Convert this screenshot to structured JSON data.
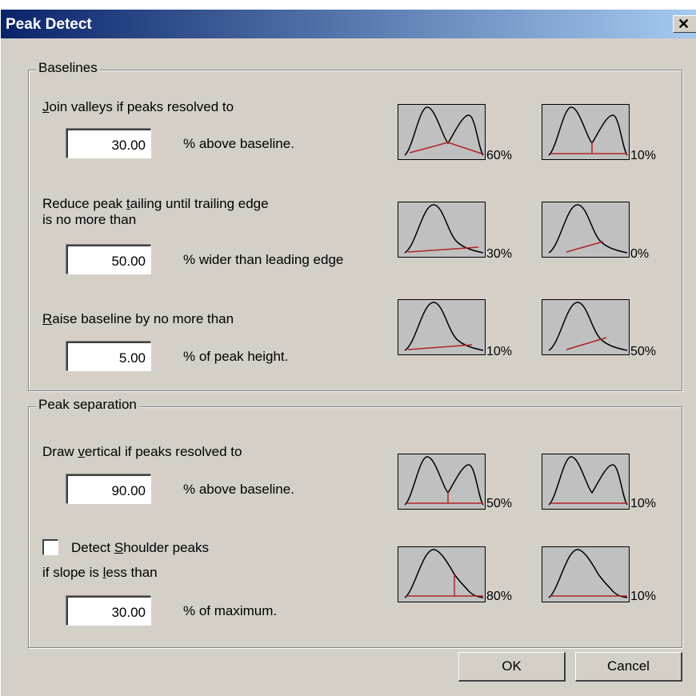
{
  "window": {
    "title": "Peak Detect",
    "close_glyph": "✕"
  },
  "baselines": {
    "legend": "Baselines",
    "join": {
      "label_pre": "",
      "label_key": "J",
      "label_post": "oin valleys if peaks resolved to",
      "value": "30.00",
      "unit": "% above baseline.",
      "thumb1_pct": "60%",
      "thumb2_pct": "10%"
    },
    "tailing": {
      "line1_pre": "Reduce peak ",
      "line1_key": "t",
      "line1_post": "ailing until trailing edge",
      "line2": "is no more than",
      "value": "50.00",
      "unit": "% wider than leading edge",
      "thumb1_pct": "30%",
      "thumb2_pct": "0%"
    },
    "raise": {
      "label_pre": "",
      "label_key": "R",
      "label_post": "aise baseline by no more than",
      "value": "5.00",
      "unit": "% of peak height.",
      "thumb1_pct": "10%",
      "thumb2_pct": "50%"
    }
  },
  "separation": {
    "legend": "Peak separation",
    "vertical": {
      "label_pre": "Draw ",
      "label_key": "v",
      "label_post": "ertical if peaks resolved to",
      "value": "90.00",
      "unit": "% above baseline.",
      "thumb1_pct": "50%",
      "thumb2_pct": "10%"
    },
    "shoulder": {
      "check_pre": "Detect ",
      "check_key": "S",
      "check_post": "houlder peaks",
      "checked": false,
      "line2_pre": "if slope is ",
      "line2_key": "l",
      "line2_post": "ess than",
      "value": "30.00",
      "unit": "% of maximum.",
      "thumb1_pct": "80%",
      "thumb2_pct": "10%"
    }
  },
  "buttons": {
    "ok": "OK",
    "cancel": "Cancel"
  },
  "colors": {
    "titlebar_start": "#0a246a",
    "titlebar_end": "#a6caf0",
    "baseline_line": "#b22222",
    "face": "#d4d0c8"
  }
}
